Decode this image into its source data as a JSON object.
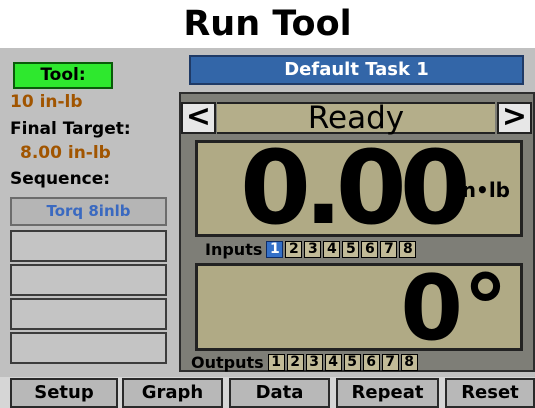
{
  "screen": {
    "title": "Run Tool",
    "task_name": "Default Task 1"
  },
  "left_panel": {
    "tool_label": "Tool:",
    "tool_value": "10 in-lb",
    "final_target_label": "Final Target:",
    "final_target_value": "8.00 in-lb",
    "sequence_label": "Sequence:",
    "sequence_button": "Torq 8inlb"
  },
  "status": {
    "prev_label": "<",
    "state": "Ready",
    "next_label": ">"
  },
  "readout": {
    "torque_value": "0.00",
    "torque_unit": "in•lb",
    "angle_value": "0°"
  },
  "inputs": {
    "label": "Inputs",
    "items": [
      {
        "label": "1",
        "active": true
      },
      {
        "label": "2",
        "active": false
      },
      {
        "label": "3",
        "active": false
      },
      {
        "label": "4",
        "active": false
      },
      {
        "label": "5",
        "active": false
      },
      {
        "label": "6",
        "active": false
      },
      {
        "label": "7",
        "active": false
      },
      {
        "label": "8",
        "active": false
      }
    ]
  },
  "outputs": {
    "label": "Outputs",
    "items": [
      {
        "label": "1",
        "active": false
      },
      {
        "label": "2",
        "active": false
      },
      {
        "label": "3",
        "active": false
      },
      {
        "label": "4",
        "active": false
      },
      {
        "label": "5",
        "active": false
      },
      {
        "label": "6",
        "active": false
      },
      {
        "label": "7",
        "active": false
      },
      {
        "label": "8",
        "active": false
      }
    ]
  },
  "bottom_nav": [
    {
      "label": "Setup",
      "name": "setup-button"
    },
    {
      "label": "Graph",
      "name": "graph-button"
    },
    {
      "label": "Data",
      "name": "data-button"
    },
    {
      "label": "Repeat",
      "name": "repeat-button"
    },
    {
      "label": "Reset",
      "name": "reset-button"
    }
  ],
  "colors": {
    "tool_label_bg": "#2ee82e",
    "task_bar_bg": "#3366a8",
    "accent_text": "#a15500",
    "active_io": "#3470c8"
  }
}
